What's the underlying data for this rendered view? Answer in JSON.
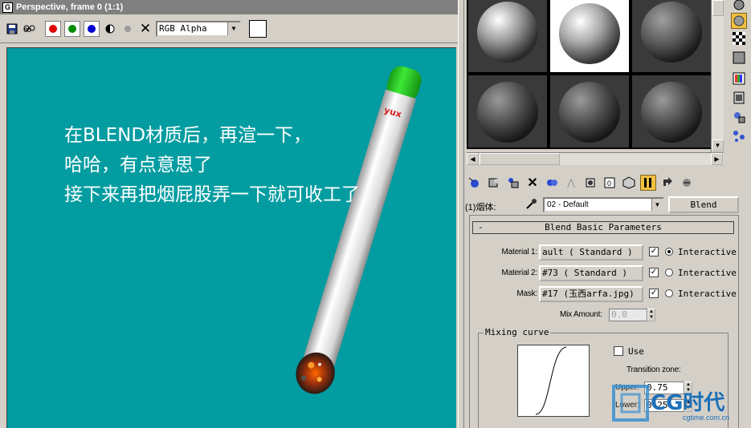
{
  "viewport": {
    "title": "Perspective, frame 0 (1:1)",
    "channel_combo": "RGB Alpha",
    "colors": {
      "background": "#039ca1",
      "filter_tip": "#2fcf2a"
    },
    "caption_lines": [
      "在BLEND材质后，再渲一下，",
      "哈哈，有点意思了",
      "接下来再把烟屁股弄一下就可收工了"
    ],
    "cigarette_print": "yux"
  },
  "material_editor": {
    "material_name_label": "(1)烟体:",
    "material_name_value": "02 - Default",
    "material_type_button": "Blend",
    "rollout_title": "Blend Basic Parameters",
    "rollout_minus": "-",
    "rows": [
      {
        "label": "Material 1:",
        "button": "ault   ( Standard )",
        "checked": true,
        "radio_on": true,
        "radio_label": "Interactive"
      },
      {
        "label": "Material 2:",
        "button": "#73   ( Standard )",
        "checked": true,
        "radio_on": false,
        "radio_label": "Interactive"
      },
      {
        "label": "Mask:",
        "button": "#17 (玉西arfa.jpg)",
        "checked": true,
        "radio_on": false,
        "radio_label": "Interactive"
      }
    ],
    "mix_amount_label": "Mix Amount:",
    "mix_amount_value": "0.0",
    "mixing_curve_title": "Mixing curve",
    "use_label": "Use",
    "transition_zone_label": "Transition zone:",
    "upper_label": "Upper:",
    "upper_value": "0.75",
    "lower_label": "Lower:",
    "lower_value": "0.25"
  },
  "watermark": {
    "brand": "CG时代",
    "url": "cgtime.com.cn"
  }
}
